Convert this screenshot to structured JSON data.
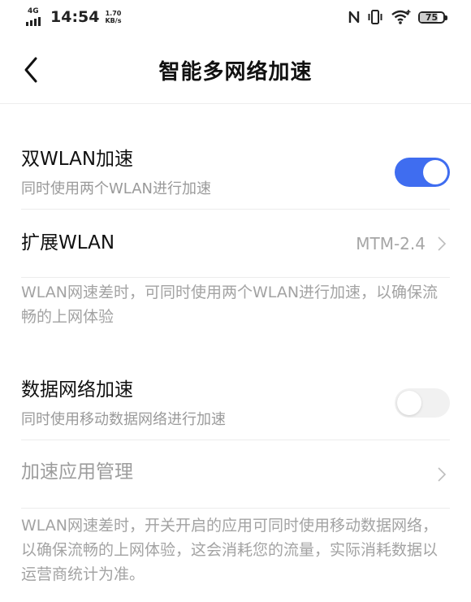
{
  "status_bar": {
    "network_type": "4G",
    "time": "14:54",
    "speed_value": "1.70",
    "speed_unit": "KB/s",
    "icons": [
      "nfc-icon",
      "vibrate-icon",
      "wifi-icon",
      "battery-icon"
    ],
    "battery_level": "75",
    "battery_fraction": 0.75
  },
  "header": {
    "back_icon": "chevron-left-icon",
    "title": "智能多网络加速"
  },
  "dual_wlan": {
    "title": "双WLAN加速",
    "subtitle": "同时使用两个WLAN进行加速",
    "enabled": true
  },
  "extend_wlan": {
    "title": "扩展WLAN",
    "value": "MTM-2.4",
    "icon": "chevron-right-icon"
  },
  "wlan_note": "WLAN网速差时，可同时使用两个WLAN进行加速，以确保流畅的上网体验",
  "data_network": {
    "title": "数据网络加速",
    "subtitle": "同时使用移动数据网络进行加速",
    "enabled": false
  },
  "app_management": {
    "title": "加速应用管理",
    "icon": "chevron-right-icon"
  },
  "data_note": "WLAN网速差时，开关开启的应用可同时使用移动数据网络，以确保流畅的上网体验，这会消耗您的流量，实际消耗数据以运营商统计为准。",
  "colors": {
    "accent": "#3f6df0",
    "secondary_text": "#9a9a9a",
    "divider": "#ececec"
  }
}
